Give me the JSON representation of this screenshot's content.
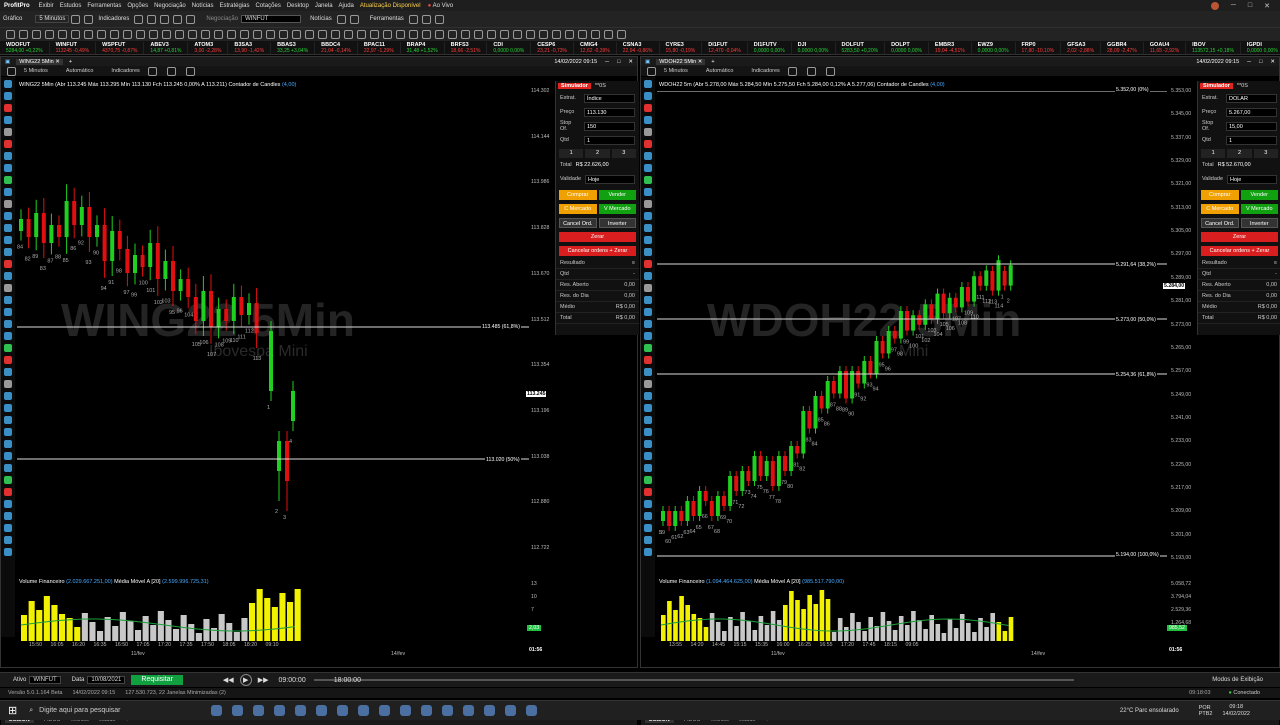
{
  "app": {
    "title": "ProfitPro",
    "menus": [
      "Exibir",
      "Estudos",
      "Ferramentas",
      "Opções",
      "Negociação",
      "Notícias",
      "Estratégias",
      "Cotações",
      "Desktop",
      "Janela",
      "Ajuda",
      "Atualização Disponível"
    ],
    "ao_vivo": "Ao Vivo"
  },
  "toolbar": {
    "grafico": "Gráfico",
    "periodo": "5 Minutos",
    "indicadores": "Indicadores",
    "negociacao": "Negociação",
    "ativo": "WINFUT",
    "noticias": "Notícias",
    "ferramentas": "Ferramentas"
  },
  "ticker": [
    {
      "n": "WDOFUT",
      "v": "5284,00 +0,22%",
      "c": "up"
    },
    {
      "n": "WINFUT",
      "v": "113245 -0,49%",
      "c": "dn"
    },
    {
      "n": "WSPFUT",
      "v": "4370,75 -0,87%",
      "c": "dn"
    },
    {
      "n": "ABEV3",
      "v": "14,87 +0,81%",
      "c": "up"
    },
    {
      "n": "ATOM3",
      "v": "3,00 -2,28%",
      "c": "dn"
    },
    {
      "n": "B3SA3",
      "v": "13,90 -1,42%",
      "c": "dn"
    },
    {
      "n": "BBAS3",
      "v": "33,25 +3,04%",
      "c": "up"
    },
    {
      "n": "BBDC4",
      "v": "21,04 -0,14%",
      "c": "dn"
    },
    {
      "n": "BPAC11",
      "v": "22,97 -1,29%",
      "c": "dn"
    },
    {
      "n": "BRAP4",
      "v": "31,48 +1,52%",
      "c": "up"
    },
    {
      "n": "BRFS3",
      "v": "18,66 -2,51%",
      "c": "dn"
    },
    {
      "n": "CDI",
      "v": "0,0000 0,00%",
      "c": "up"
    },
    {
      "n": "CESP6",
      "v": "23,21 -0,73%",
      "c": "dn"
    },
    {
      "n": "CMIG4",
      "v": "12,62 -0,39%",
      "c": "dn"
    },
    {
      "n": "CSNA3",
      "v": "22,94 -0,86%",
      "c": "dn"
    },
    {
      "n": "CYRE3",
      "v": "15,80 -0,19%",
      "c": "dn"
    },
    {
      "n": "DI1FUT",
      "v": "12,470 -0,04%",
      "c": "dn"
    },
    {
      "n": "DI1FUTV",
      "v": "0,0000 0,00%",
      "c": "up"
    },
    {
      "n": "DJI",
      "v": "0,0000 0,00%",
      "c": "up"
    },
    {
      "n": "DOLFUT",
      "v": "5283,50 +0,20%",
      "c": "up"
    },
    {
      "n": "DOLPT",
      "v": "0,0000 0,00%",
      "c": "up"
    },
    {
      "n": "EMBR3",
      "v": "19,04 -4,51%",
      "c": "dn"
    },
    {
      "n": "EWZ9",
      "v": "0,0000 0,00%",
      "c": "up"
    },
    {
      "n": "FRP0",
      "v": "17,80 -10,10%",
      "c": "dn"
    },
    {
      "n": "GFSA3",
      "v": "2,02 -2,88%",
      "c": "dn"
    },
    {
      "n": "GGBR4",
      "v": "28,09 -2,47%",
      "c": "dn"
    },
    {
      "n": "GOAU4",
      "v": "11,65 -2,92%",
      "c": "dn"
    },
    {
      "n": "IBOV",
      "v": "113572,15 +0,18%",
      "c": "up"
    },
    {
      "n": "IGPDI",
      "v": "0,0000 0,00%",
      "c": "up"
    }
  ],
  "left": {
    "date": "14/02/2022 09:15",
    "periodo": "5 Minutos",
    "auto": "Automático",
    "indicadores": "Indicadores",
    "ohlc": "WING22 5Min (Abr 113.245 Máx 113.295 Mín 113.130 Fch 113.245 0,00% A 113.211)",
    "contador": "Contador de Candles",
    "contador_n": "(4,00)",
    "wm": "WING22 5Min",
    "wm2": "Ibovespa Mini",
    "yaxis": [
      "114.302",
      "114.144",
      "113.986",
      "113.828",
      "113.670",
      "113.512",
      "113.354",
      "113.196",
      "113.038",
      "112.880",
      "112.722"
    ],
    "fib": [
      {
        "l": "113.485 (61,8%)"
      },
      {
        "l": "113.020 (50%)"
      }
    ],
    "price": "113.245",
    "vol": "Volume Financeiro",
    "vol_v": "(2.029.667.251,00)",
    "mm": "Média Móvel A [20]",
    "mm_v": "(2.599.996.725,31)",
    "vol_y": [
      "13",
      "10",
      "7"
    ],
    "vol_tag": "2,03",
    "xaxis": [
      "15:50",
      "16:05",
      "16:20",
      "16:35",
      "16:50",
      "17:05",
      "17:20",
      "17:35",
      "17:50",
      "18:05",
      "18:20",
      "09:10"
    ],
    "xdate1": "11/fev",
    "xdate2": "14/fev",
    "clock": "01:56",
    "labels": [
      "84",
      "82",
      "89",
      "83",
      "87",
      "88",
      "85",
      "86",
      "92",
      "93",
      "90",
      "94",
      "91",
      "98",
      "97",
      "99",
      "100",
      "101",
      "102",
      "103",
      "95",
      "96",
      "104",
      "105",
      "106",
      "107",
      "108",
      "109",
      "110",
      "111",
      "112",
      "113",
      "1",
      "2",
      "3",
      "4"
    ]
  },
  "sim_l": {
    "tag": "Simulador",
    "os": "**0S",
    "estrat": "Estrat.",
    "estrat_v": "Índice",
    "preco": "Preço",
    "preco_v": "113.130",
    "stop": "Stop Of.",
    "stop_v": "150",
    "qtd": "Qtd",
    "qtd_v": "1",
    "q": [
      "1",
      "2",
      "3"
    ],
    "total": "Total",
    "total_v": "R$ 22.626,00",
    "validade": "Validade",
    "validade_v": "Hoje",
    "comprar": "Comprar",
    "vender": "Vender",
    "cm": "C Mercado",
    "vm": "V Mercado",
    "cancel": "Cancel Ord.",
    "inverter": "Inverter",
    "zerar": "Zerar",
    "cz": "Cancelar ordens + Zerar",
    "resultado": "Resultado",
    "rows": [
      {
        "k": "Qtd",
        "v": "-"
      },
      {
        "k": "Res. Aberto",
        "v": "0,00"
      },
      {
        "k": "Res. do Dia",
        "v": "0,00"
      },
      {
        "k": "Médio",
        "v": "R$ 0,00"
      },
      {
        "k": "Total",
        "v": "R$ 0,00"
      }
    ]
  },
  "right": {
    "date": "14/02/2022 09:15",
    "periodo": "5 Minutos",
    "auto": "Automático",
    "indicadores": "Indicadores",
    "ohlc": "WDOH22 5m (Abr 5.278,00 Máx 5.284,50 Mín 5.275,50 Fch 5.284,00 0,12% A 5.277,06)",
    "contador": "Contador de Candles",
    "contador_n": "(4,00)",
    "wm": "WDOH22 5Min",
    "wm2": "Mini",
    "yaxis": [
      "5.353,00",
      "5.345,00",
      "5.337,00",
      "5.329,00",
      "5.321,00",
      "5.313,00",
      "5.305,00",
      "5.297,00",
      "5.289,00",
      "5.281,00",
      "5.273,00",
      "5.265,00",
      "5.257,00",
      "5.249,00",
      "5.241,00",
      "5.233,00",
      "5.225,00",
      "5.217,00",
      "5.209,00",
      "5.201,00",
      "5.193,00"
    ],
    "fib": [
      {
        "l": "5.352,00 (0%)"
      },
      {
        "l": "5.291,64 (38,2%)"
      },
      {
        "l": "5.273,00 (50,0%)"
      },
      {
        "l": "5.254,36 (61,8%)"
      },
      {
        "l": "5.194,00 (100,0%)"
      }
    ],
    "price": "5.284,00",
    "vol": "Volume Financeiro",
    "vol_v": "(1.094.464.625,00)",
    "mm": "Média Móvel A [20]",
    "mm_v": "(985.517.790,00)",
    "vol_y": [
      "5.058,72",
      "3.794,04",
      "2.529,36",
      "1.264,68"
    ],
    "vol_tag": "985,52",
    "xaxis": [
      "13:55",
      "14:20",
      "14:45",
      "15:15",
      "15:35",
      "16:00",
      "16:25",
      "16:55",
      "17:20",
      "17:45",
      "18:15",
      "09:05"
    ],
    "xdate1": "11/fev",
    "xdate2": "14/fev",
    "clock": "01:56",
    "labels": [
      "59",
      "60",
      "61",
      "62",
      "63",
      "64",
      "65",
      "66",
      "67",
      "68",
      "69",
      "70",
      "71",
      "72",
      "73",
      "74",
      "75",
      "76",
      "77",
      "78",
      "79",
      "80",
      "81",
      "82",
      "83",
      "84",
      "85",
      "86",
      "87",
      "88",
      "89",
      "90",
      "91",
      "92",
      "93",
      "94",
      "95",
      "96",
      "97",
      "98",
      "99",
      "100",
      "101",
      "102",
      "103",
      "104",
      "105",
      "106",
      "107",
      "108",
      "109",
      "110",
      "111",
      "112",
      "113",
      "114",
      "1",
      "2",
      "3"
    ]
  },
  "sim_r": {
    "tag": "Simulador",
    "os": "**0S",
    "estrat": "Estrat.",
    "estrat_v": "DOLAR",
    "preco": "Preço",
    "preco_v": "5.267,00",
    "stop": "Stop Of.",
    "stop_v": "15,00",
    "qtd": "Qtd",
    "qtd_v": "1",
    "q": [
      "1",
      "2",
      "3"
    ],
    "total": "Total",
    "total_v": "R$ 52.670,00",
    "validade": "Validade",
    "validade_v": "Hoje",
    "comprar": "Comprar",
    "vender": "Vender",
    "cm": "C Mercado",
    "vm": "V Mercado",
    "cancel": "Cancel Ord.",
    "inverter": "Inverter",
    "zerar": "Zerar",
    "cz": "Cancelar ordens + Zerar",
    "resultado": "Resultado",
    "rows": [
      {
        "k": "Qtd",
        "v": "-"
      },
      {
        "k": "Res. Aberto",
        "v": "0,00"
      },
      {
        "k": "Res. do Dia",
        "v": "0,00"
      },
      {
        "k": "Médio",
        "v": "R$ 0,00"
      },
      {
        "k": "Total",
        "v": "R$ 0,00"
      }
    ]
  },
  "sheets": [
    "DEILON",
    "FIBOS",
    "Tecnico",
    "estudo"
  ],
  "status": {
    "ativo": "Ativo",
    "ativo_v": "WINFUT",
    "data": "Data",
    "data_v": "10/08/2021",
    "requisitar": "Requisitar",
    "t0": "09:00:00",
    "t1": "18:00:00",
    "modos": "Modos de Exibição"
  },
  "status2": {
    "versao": "Versão 5.0.1.164 Beta",
    "dt": "14/02/2022 09:15",
    "mem": "127.530.723, 22 Janelas Minimizadas (2)",
    "clock": "09:18:03",
    "con": "Conectado"
  },
  "taskbar": {
    "search": "Digite aqui para pesquisar",
    "weather": "22°C Parc ensolarado",
    "lang": "POR",
    "lang2": "PTB2",
    "time": "09:18",
    "date": "14/02/2022"
  }
}
